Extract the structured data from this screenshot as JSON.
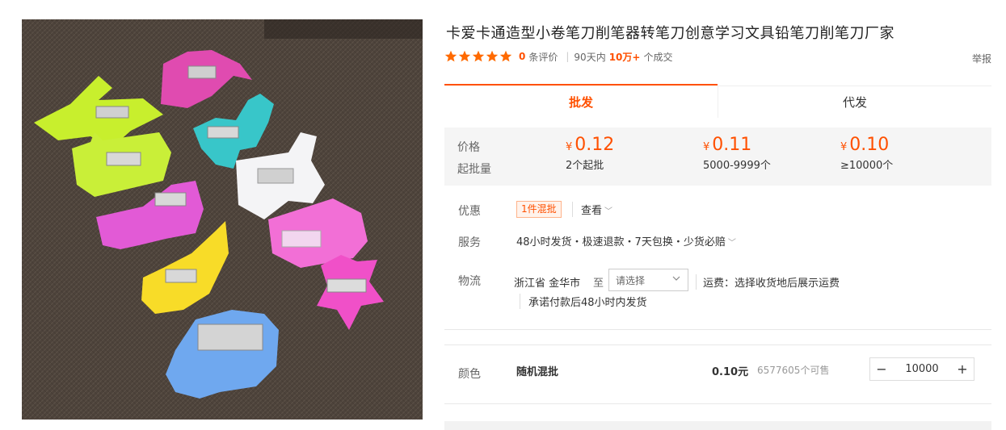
{
  "product": {
    "title": "卡爱卡通造型小卷笔刀削笔器转笔刀创意学习文具铅笔刀削笔刀厂家",
    "image_alt": "animal shaped pencil sharpeners"
  },
  "rating": {
    "stars": 5,
    "review_count": "0",
    "review_label": "条评价",
    "period_label": "90天内",
    "deals_count": "10万+",
    "deals_label": "个成交"
  },
  "report_label": "举报",
  "tabs": [
    {
      "label": "批发"
    },
    {
      "label": "代发"
    }
  ],
  "pricing": {
    "price_label": "价格",
    "moq_label": "起批量",
    "currency": "¥",
    "tiers": [
      {
        "price": "0.12",
        "qty": "2个起批"
      },
      {
        "price": "0.11",
        "qty": "5000-9999个"
      },
      {
        "price": "0.10",
        "qty": "≥10000个"
      }
    ]
  },
  "promo": {
    "label": "优惠",
    "tag": "1件混批",
    "view_label": "查看"
  },
  "service": {
    "label": "服务",
    "text": "48小时发货・极速退款・7天包换・少货必赔"
  },
  "logistics": {
    "label": "物流",
    "origin": "浙江省 金华市",
    "to_label": "至",
    "select_placeholder": "请选择",
    "freight": "运费：选择收货地后展示运费",
    "promise": "承诺付款后48小时内发货"
  },
  "sku": {
    "label": "颜色",
    "name": "随机混批",
    "price": "0.10元",
    "stock": "6577605个可售",
    "quantity": "10000",
    "minus": "−",
    "plus": "+"
  },
  "colors": {
    "accent": "#ff5000",
    "star": "#ff6a00"
  }
}
